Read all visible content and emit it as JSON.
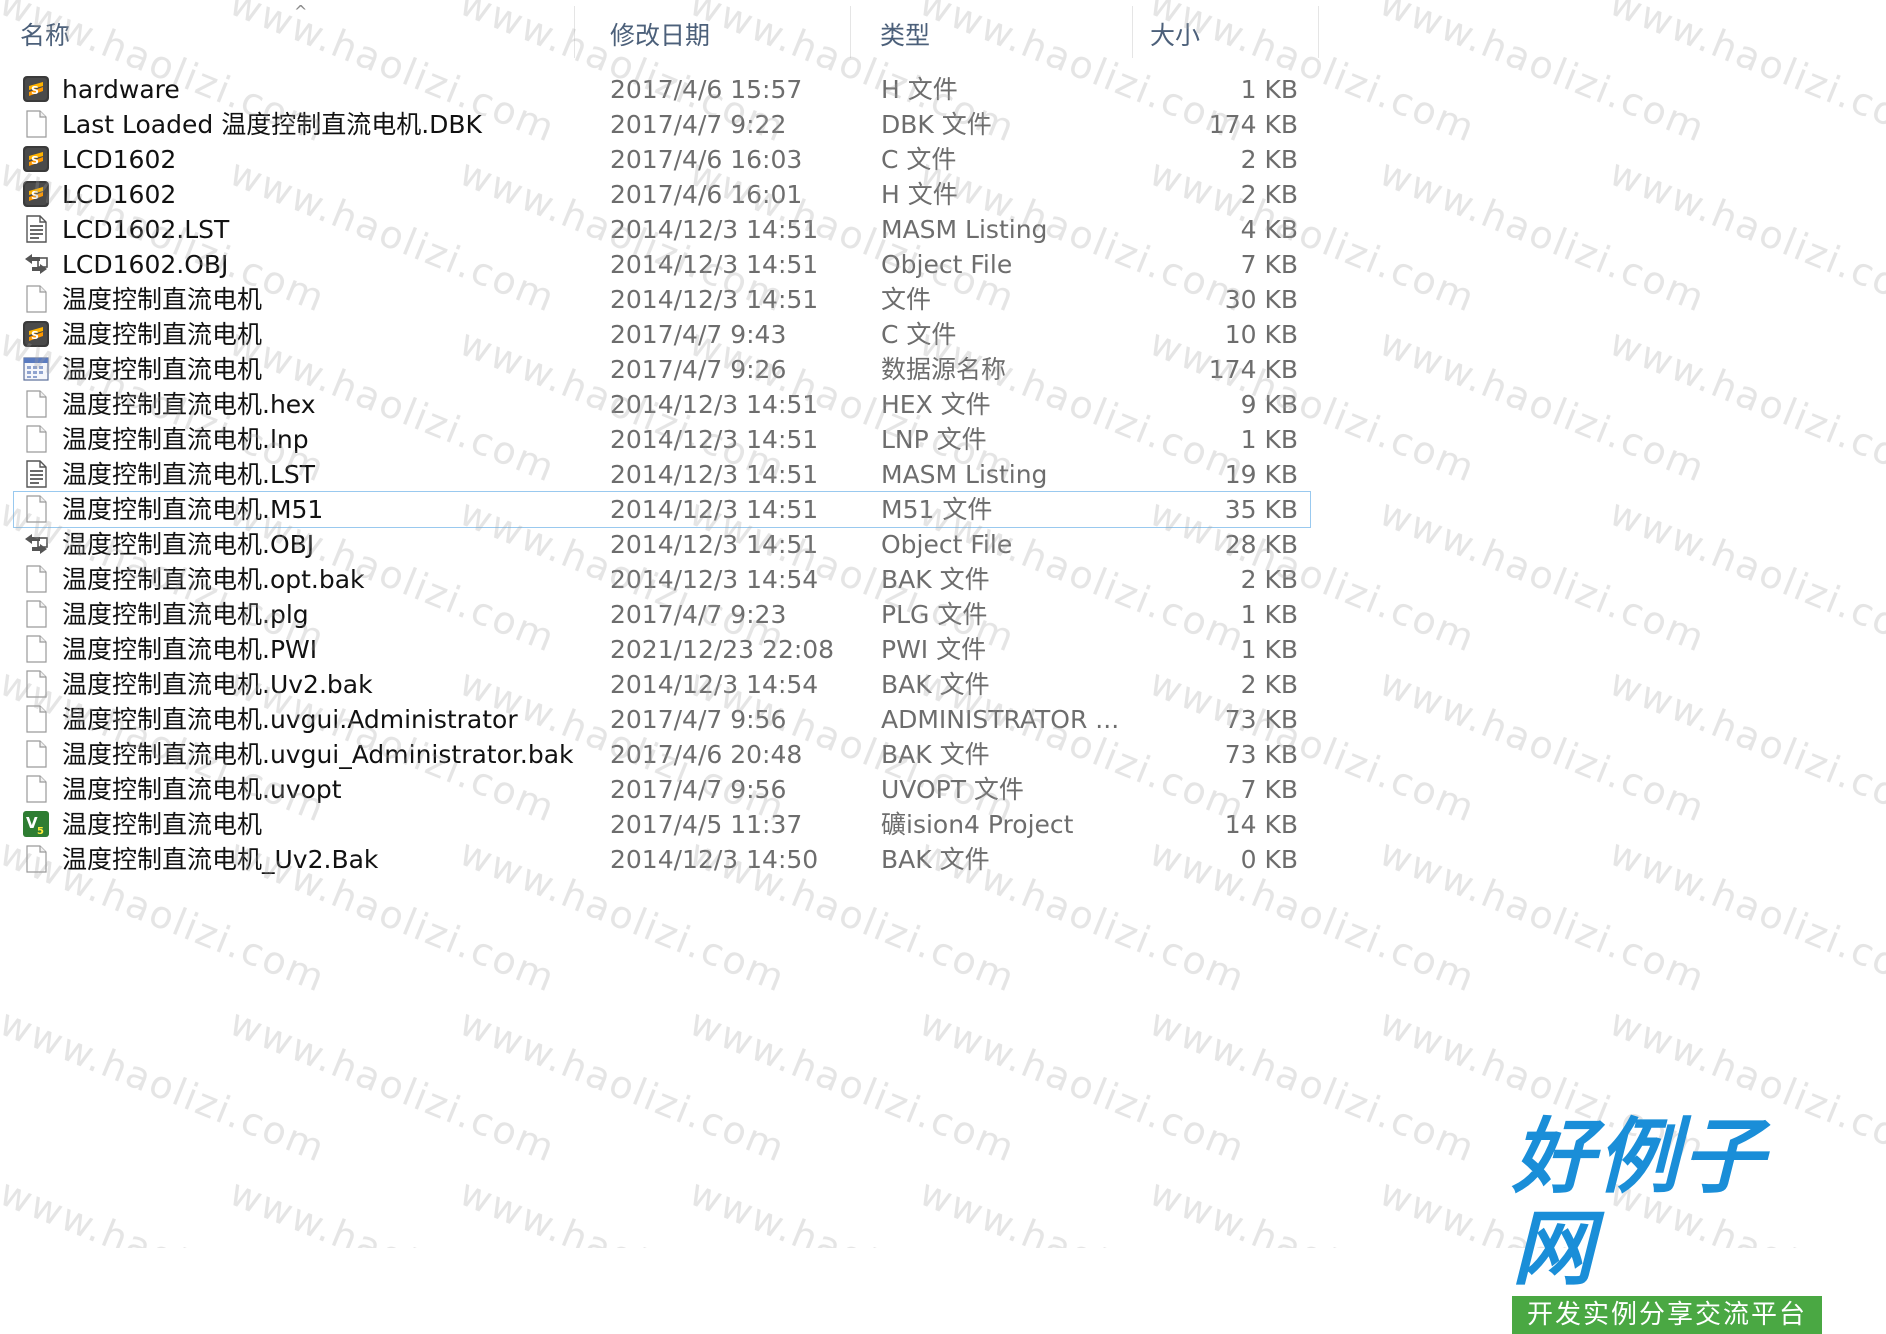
{
  "header": {
    "name": "名称",
    "date": "修改日期",
    "type": "类型",
    "size": "大小",
    "sort_indicator": "^"
  },
  "files": [
    {
      "name": "hardware",
      "date": "2017/4/6 15:57",
      "type": "H 文件",
      "size": "1 KB",
      "icon": "sublime-icon"
    },
    {
      "name": "Last Loaded 温度控制直流电机.DBK",
      "date": "2017/4/7 9:22",
      "type": "DBK 文件",
      "size": "174 KB",
      "icon": "blank-file-icon"
    },
    {
      "name": "LCD1602",
      "date": "2017/4/6 16:03",
      "type": "C 文件",
      "size": "2 KB",
      "icon": "sublime-icon"
    },
    {
      "name": "LCD1602",
      "date": "2017/4/6 16:01",
      "type": "H 文件",
      "size": "2 KB",
      "icon": "sublime-icon"
    },
    {
      "name": "LCD1602.LST",
      "date": "2014/12/3 14:51",
      "type": "MASM Listing",
      "size": "4 KB",
      "icon": "text-file-icon"
    },
    {
      "name": "LCD1602.OBJ",
      "date": "2014/12/3 14:51",
      "type": "Object File",
      "size": "7 KB",
      "icon": "object-file-icon"
    },
    {
      "name": "温度控制直流电机",
      "date": "2014/12/3 14:51",
      "type": "文件",
      "size": "30 KB",
      "icon": "blank-file-icon"
    },
    {
      "name": "温度控制直流电机",
      "date": "2017/4/7 9:43",
      "type": "C 文件",
      "size": "10 KB",
      "icon": "sublime-icon"
    },
    {
      "name": "温度控制直流电机",
      "date": "2017/4/7 9:26",
      "type": "数据源名称",
      "size": "174 KB",
      "icon": "datasource-icon"
    },
    {
      "name": "温度控制直流电机.hex",
      "date": "2014/12/3 14:51",
      "type": "HEX 文件",
      "size": "9 KB",
      "icon": "blank-file-icon"
    },
    {
      "name": "温度控制直流电机.lnp",
      "date": "2014/12/3 14:51",
      "type": "LNP 文件",
      "size": "1 KB",
      "icon": "blank-file-icon"
    },
    {
      "name": "温度控制直流电机.LST",
      "date": "2014/12/3 14:51",
      "type": "MASM Listing",
      "size": "19 KB",
      "icon": "text-file-icon"
    },
    {
      "name": "温度控制直流电机.M51",
      "date": "2014/12/3 14:51",
      "type": "M51 文件",
      "size": "35 KB",
      "icon": "blank-file-icon",
      "focused": true
    },
    {
      "name": "温度控制直流电机.OBJ",
      "date": "2014/12/3 14:51",
      "type": "Object File",
      "size": "28 KB",
      "icon": "object-file-icon"
    },
    {
      "name": "温度控制直流电机.opt.bak",
      "date": "2014/12/3 14:54",
      "type": "BAK 文件",
      "size": "2 KB",
      "icon": "blank-file-icon"
    },
    {
      "name": "温度控制直流电机.plg",
      "date": "2017/4/7 9:23",
      "type": "PLG 文件",
      "size": "1 KB",
      "icon": "blank-file-icon"
    },
    {
      "name": "温度控制直流电机.PWI",
      "date": "2021/12/23 22:08",
      "type": "PWI 文件",
      "size": "1 KB",
      "icon": "blank-file-icon"
    },
    {
      "name": "温度控制直流电机.Uv2.bak",
      "date": "2014/12/3 14:54",
      "type": "BAK 文件",
      "size": "2 KB",
      "icon": "blank-file-icon"
    },
    {
      "name": "温度控制直流电机.uvgui.Administrator",
      "date": "2017/4/7 9:56",
      "type": "ADMINISTRATOR ...",
      "size": "73 KB",
      "icon": "blank-file-icon"
    },
    {
      "name": "温度控制直流电机.uvgui_Administrator.bak",
      "date": "2017/4/6 20:48",
      "type": "BAK 文件",
      "size": "73 KB",
      "icon": "blank-file-icon"
    },
    {
      "name": "温度控制直流电机.uvopt",
      "date": "2017/4/7 9:56",
      "type": "UVOPT 文件",
      "size": "7 KB",
      "icon": "blank-file-icon"
    },
    {
      "name": "温度控制直流电机",
      "date": "2017/4/5 11:37",
      "type": "礦ision4 Project",
      "size": "14 KB",
      "icon": "uvision-icon"
    },
    {
      "name": "温度控制直流电机_Uv2.Bak",
      "date": "2014/12/3 14:50",
      "type": "BAK 文件",
      "size": "0 KB",
      "icon": "blank-file-icon"
    }
  ],
  "watermark": {
    "text": "www.haolizi.com"
  },
  "logo": {
    "title": "好例子网",
    "subtitle": "开发实例分享交流平台",
    "title_color": "#1a8ed8",
    "subtitle_bg": "#4aa843"
  },
  "colors": {
    "focus_outline": "#99c9ef",
    "header_text": "#4c607a",
    "secondary_text": "#6d6d6d"
  }
}
